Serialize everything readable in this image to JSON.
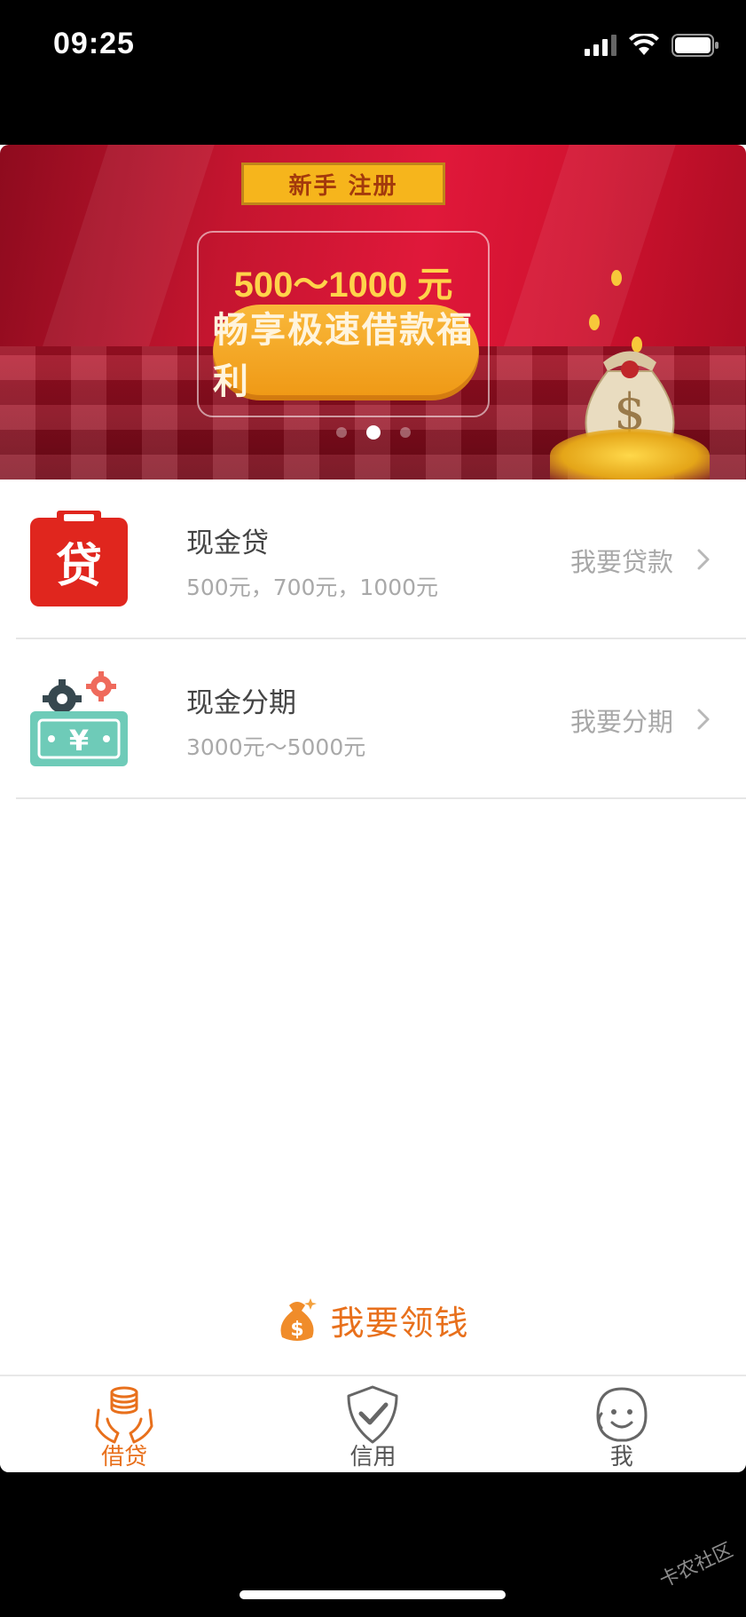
{
  "status_bar": {
    "time": "09:25"
  },
  "banner": {
    "badge": "新手 注册",
    "amount": "500～1000 元",
    "promo": "畅享极速借款福利",
    "slide_count": 3,
    "active_slide": 2
  },
  "products": [
    {
      "title": "现金贷",
      "subtitle": "500元，700元，1000元",
      "action": "我要贷款",
      "icon": "loan-icon",
      "icon_text": "贷",
      "color": "#e0261e"
    },
    {
      "title": "现金分期",
      "subtitle": "3000元～5000元",
      "action": "我要分期",
      "icon": "installment-icon",
      "icon_text": "¥",
      "color": "#6ecbb8"
    }
  ],
  "cta": {
    "label": "我要领钱",
    "icon": "money-bag-icon"
  },
  "tabs": [
    {
      "label": "借贷",
      "icon": "hands-coins-icon",
      "active": true
    },
    {
      "label": "信用",
      "icon": "shield-check-icon",
      "active": false
    },
    {
      "label": "我",
      "icon": "smiley-face-icon",
      "active": false
    }
  ],
  "watermark": "卡农社区",
  "colors": {
    "accent": "#e8701c",
    "banner_red": "#e0183a",
    "gold": "#f6b51c"
  }
}
